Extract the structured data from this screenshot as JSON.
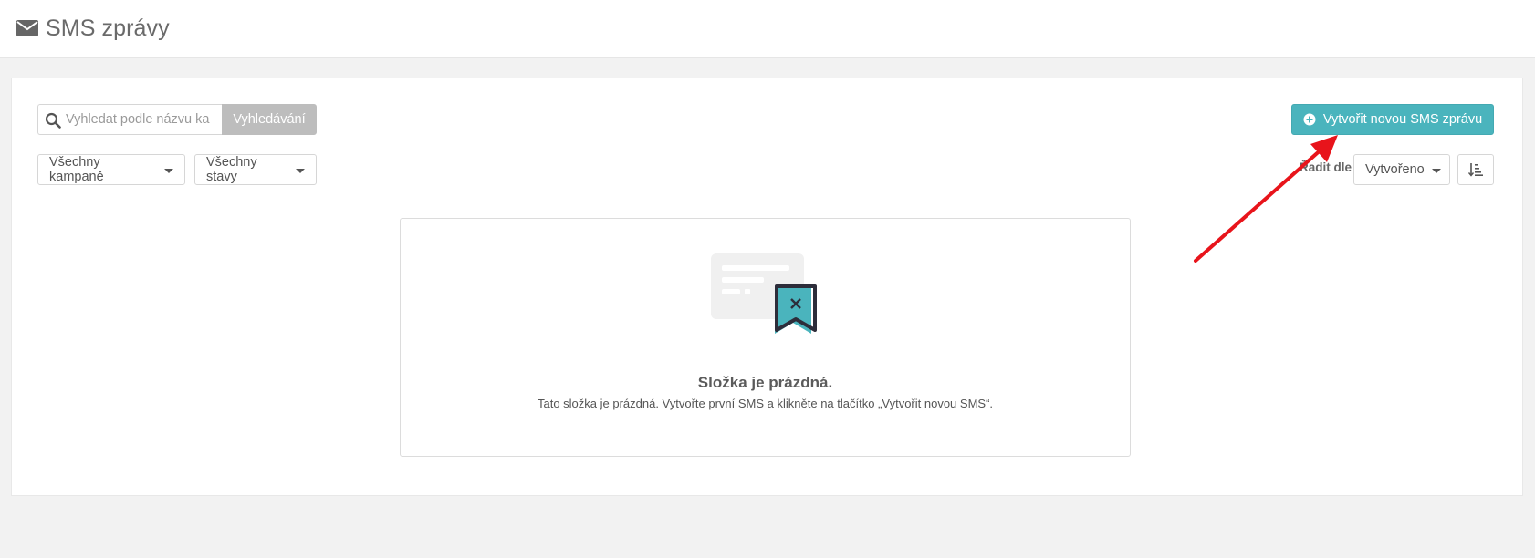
{
  "header": {
    "title": "SMS zprávy",
    "icon": "envelope-icon"
  },
  "search": {
    "placeholder": "Vyhledat podle názvu ka",
    "value": "",
    "button_label": "Vyhledávání"
  },
  "filters": {
    "campaigns_label": "Všechny kampaně",
    "states_label": "Všechny stavy"
  },
  "actions": {
    "create_label": "Vytvořit novou SMS zprávu",
    "create_icon": "plus-circle-icon"
  },
  "sort": {
    "label": "Řadit dle",
    "selected": "Vytvořeno",
    "direction_icon": "sort-amount-down-icon"
  },
  "empty_state": {
    "title": "Složka je prázdná.",
    "text": "Tato složka je prázdná. Vytvořte první SMS a klikněte na tlačítko „Vytvořit novou SMS“."
  },
  "colors": {
    "accent": "#4ab4bd",
    "search_button": "#bdbdbd",
    "annotation_arrow": "#e8141b",
    "page_background": "#f2f2f2"
  }
}
